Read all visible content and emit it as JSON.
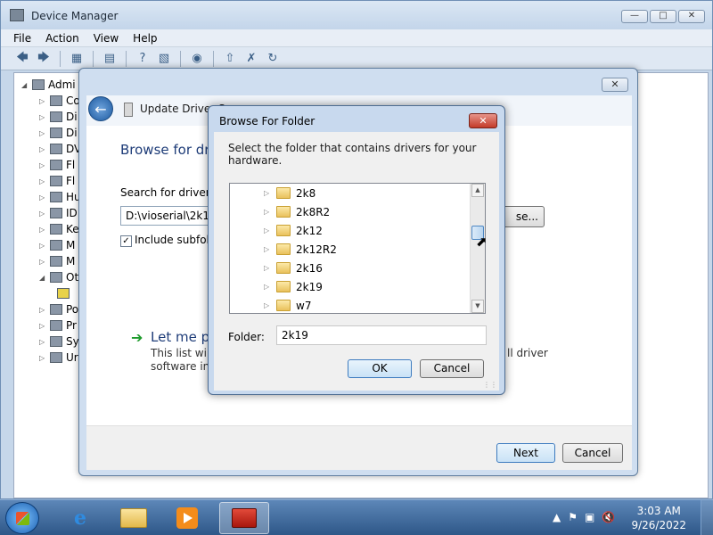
{
  "main_window": {
    "title": "Device Manager",
    "menu": [
      "File",
      "Action",
      "View",
      "Help"
    ],
    "tree_root": "Admi",
    "tree_items": [
      "Co",
      "Di",
      "Di",
      "DV",
      "Fl",
      "Fl",
      "Hu",
      "ID",
      "Ke",
      "M",
      "M",
      "Ot",
      "",
      "Po",
      "Pr",
      "Sy",
      "Ur"
    ]
  },
  "wizard": {
    "title": "Update Driver S",
    "heading": "Browse for dri",
    "search_label": "Search for driver so",
    "path_value": "D:\\vioserial\\2k19",
    "browse_button": "se...",
    "include_subfolders": "Include subfold",
    "letme_title": "Let me pi",
    "letme_desc_line1": "This list will s",
    "letme_desc_tail": "ll driver",
    "letme_desc_line2": "software in t",
    "next_button": "Next",
    "cancel_button": "Cancel"
  },
  "browse_folder": {
    "title": "Browse For Folder",
    "description": "Select the folder that contains drivers for your hardware.",
    "folders": [
      "2k8",
      "2k8R2",
      "2k12",
      "2k12R2",
      "2k16",
      "2k19",
      "w7"
    ],
    "folder_label": "Folder:",
    "folder_value": "2k19",
    "ok_button": "OK",
    "cancel_button": "Cancel"
  },
  "taskbar": {
    "time": "3:03 AM",
    "date": "9/26/2022"
  }
}
